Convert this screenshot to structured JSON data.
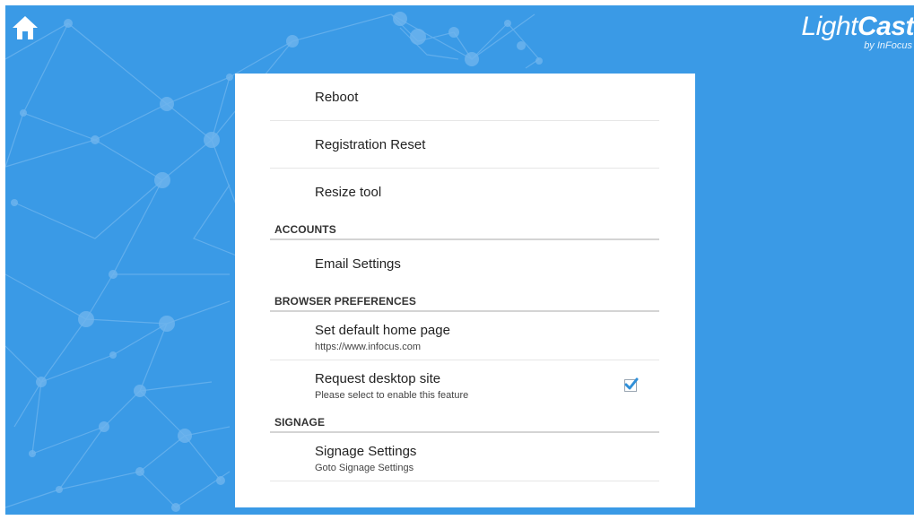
{
  "brand": {
    "logo_light": "Light",
    "logo_cast": "Cast",
    "logo_sub": "by InFocus"
  },
  "header": {
    "home_icon": "home-icon"
  },
  "settings": {
    "top_items": [
      {
        "title": "Reboot"
      },
      {
        "title": "Registration Reset"
      },
      {
        "title": "Resize tool"
      }
    ],
    "accounts": {
      "header": "ACCOUNTS",
      "email_settings": "Email Settings"
    },
    "browser": {
      "header": "BROWSER PREFERENCES",
      "home_page": {
        "title": "Set default home page",
        "summary": "https://www.infocus.com"
      },
      "desktop_site": {
        "title": "Request desktop site",
        "summary": "Please select to enable this feature",
        "checked": true
      }
    },
    "signage": {
      "header": "SIGNAGE",
      "settings": {
        "title": "Signage Settings",
        "summary": "Goto Signage Settings"
      }
    }
  },
  "colors": {
    "background": "#3a9ae6",
    "panel": "#ffffff",
    "check_accent": "#2f8fd8"
  }
}
